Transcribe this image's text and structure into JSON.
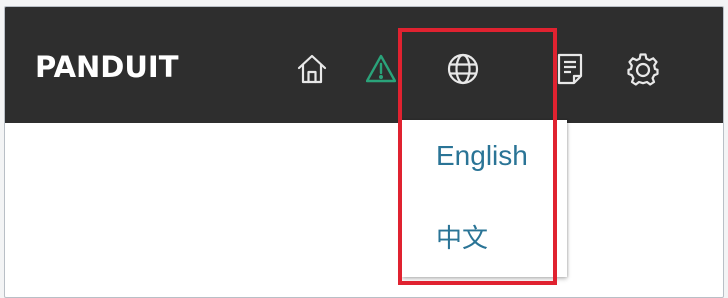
{
  "header": {
    "logo_text": "PANDUIT",
    "background": "#2e2e2e",
    "icons": {
      "home": "home-icon",
      "warning": "warning-icon",
      "language": "globe-icon",
      "report": "report-icon",
      "settings": "gear-icon"
    },
    "warning_color": "#2aa37a"
  },
  "language_menu": {
    "options": [
      {
        "label": "English"
      },
      {
        "label": "中文"
      }
    ],
    "link_color": "#2a7496"
  },
  "annotation": {
    "highlight_color": "#e02230"
  }
}
